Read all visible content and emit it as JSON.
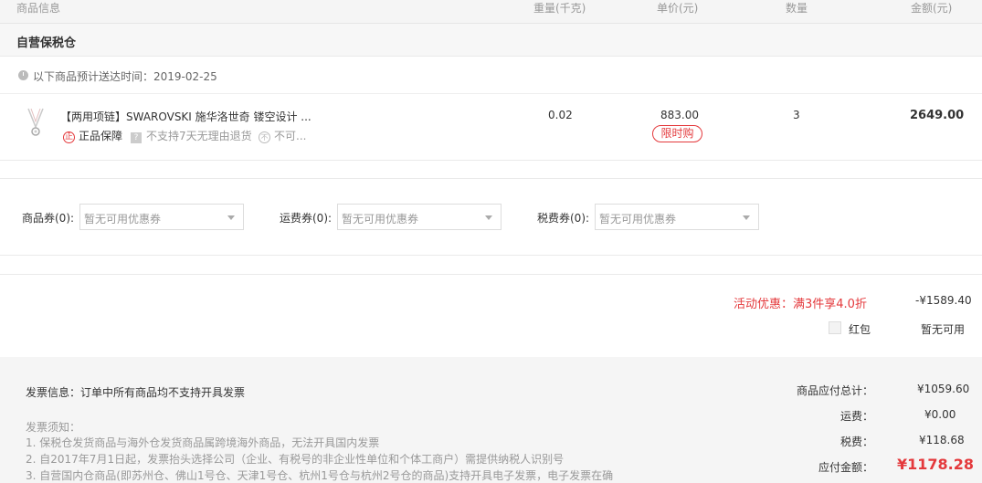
{
  "header": {
    "col_product": "商品信息",
    "col_weight": "重量(千克)",
    "col_price": "单价(元)",
    "col_qty": "数量",
    "col_amount": "金额(元)"
  },
  "warehouse": {
    "title": "自营保税仓"
  },
  "delivery": {
    "text": "以下商品预计送达时间：2019-02-25"
  },
  "item": {
    "title": "【两用项链】SWAROVSKI 施华洛世奇 镂空设计 ...",
    "service_authentic": "正品保障",
    "service_noreturn": "不支持7天无理由退货",
    "service_more": "不可...",
    "badge_authentic": "正",
    "badge_q": "?",
    "badge_x": "不",
    "weight": "0.02",
    "price": "883.00",
    "tag": "限时购",
    "qty": "3",
    "amount": "2649.00"
  },
  "coupons": [
    {
      "label": "商品券(0):",
      "placeholder": "暂无可用优惠券"
    },
    {
      "label": "运费券(0):",
      "placeholder": "暂无可用优惠券"
    },
    {
      "label": "税费券(0):",
      "placeholder": "暂无可用优惠券"
    }
  ],
  "promo": {
    "label": "活动优惠：满3件享4.0折",
    "value": "-¥1589.40",
    "redpacket_label": "红包",
    "redpacket_value": "暂无可用"
  },
  "invoice": {
    "info": "发票信息：订单中所有商品均不支持开具发票",
    "notice_title": "发票须知：",
    "notes": [
      "1. 保税仓发货商品与海外仓发货商品属跨境海外商品，无法开具国内发票",
      "2. 自2017年7月1日起，发票抬头选择公司（企业、有税号的非企业性单位和个体工商户）需提供纳税人识别号",
      "3. 自营国内仓商品(即苏州仓、佛山1号仓、天津1号仓、杭州1号仓与杭州2号仓的商品)支持开具电子发票，电子发票在确"
    ]
  },
  "summary": {
    "subtotal_label": "商品应付总计：",
    "subtotal_value": "¥1059.60",
    "shipping_label": "运费：",
    "shipping_value": "¥0.00",
    "tax_label": "税费：",
    "tax_value": "¥118.68",
    "total_label": "应付金额：",
    "total_value": "¥1178.28"
  },
  "colors": {
    "accent": "#e4393c",
    "muted": "#999999",
    "panel": "#f5f5f5"
  }
}
